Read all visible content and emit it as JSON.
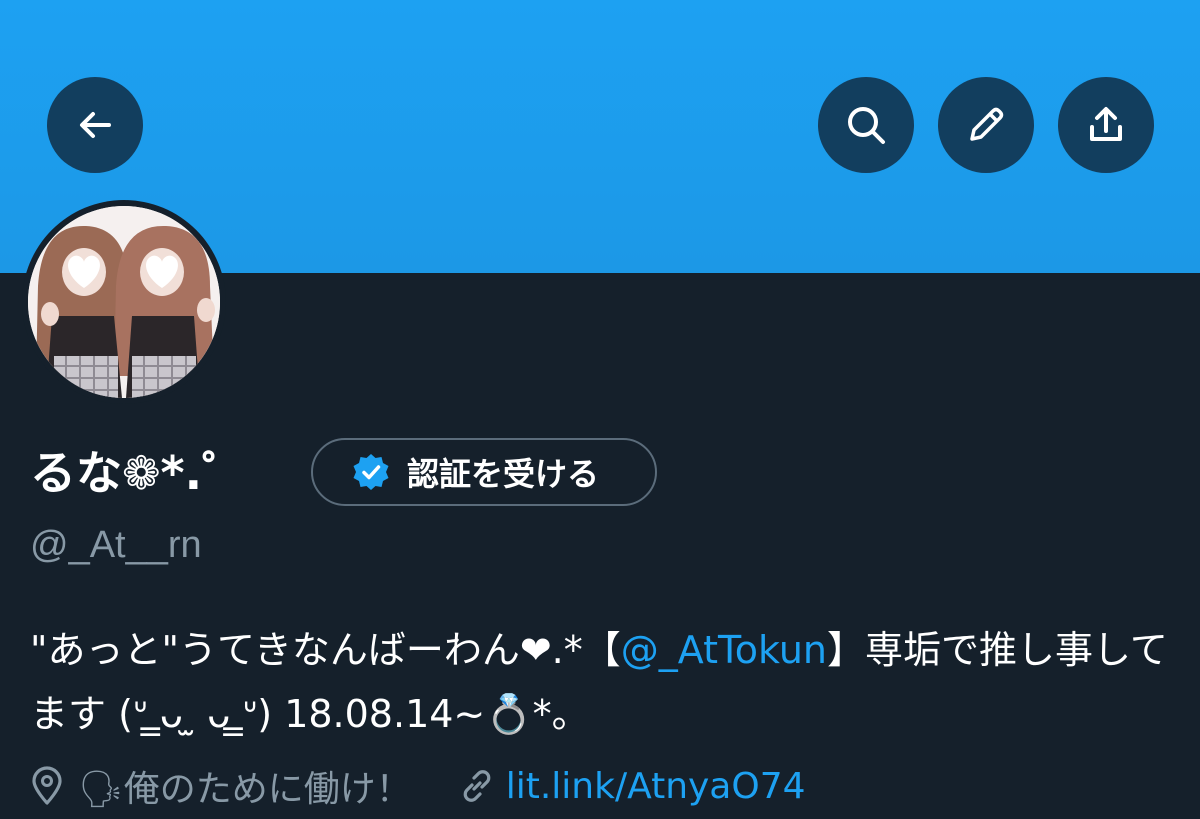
{
  "header": {
    "back_icon": "arrow-left-icon",
    "search_icon": "search-icon",
    "edit_icon": "pencil-icon",
    "share_icon": "share-upload-icon",
    "banner_color": "#1da1f2"
  },
  "profile": {
    "display_name": "るな❁*.゜",
    "verify_button_label": "認証を受ける",
    "verify_badge_icon": "verified-badge-icon",
    "handle": "@_At__rn",
    "bio": {
      "part1": "\"あっと\"うてきなんばーわん❤︎.*【",
      "mention": "@_AtTokun",
      "part2": "】専垢で推し事してます (ᐡ ̳ᴗ  ̫ ᴗ ̳ᐡ) 18.08.14~💍*。"
    },
    "location": "🗣俺のために働け！",
    "location_icon": "location-pin-icon",
    "website": "lit.link/AtnyaO74",
    "website_icon": "link-icon"
  },
  "colors": {
    "background": "#15202b",
    "accent": "#1da1f2",
    "secondary_text": "#8899a6"
  }
}
